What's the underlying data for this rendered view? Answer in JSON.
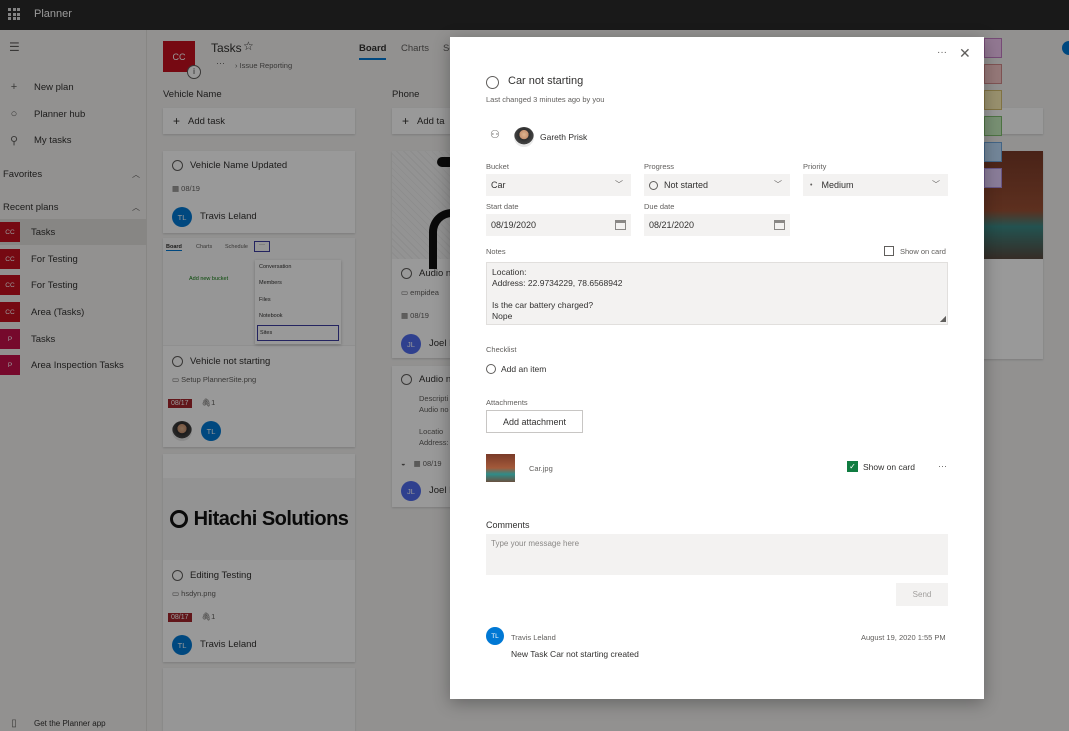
{
  "app": {
    "title": "Planner"
  },
  "nav": {
    "new_plan": "New plan",
    "planner_hub": "Planner hub",
    "my_tasks": "My tasks",
    "favorites": "Favorites",
    "recent_plans": "Recent plans",
    "plans": [
      {
        "initials": "CC",
        "name": "Tasks",
        "color": "#c50f1f"
      },
      {
        "initials": "CC",
        "name": "For Testing",
        "color": "#c50f1f"
      },
      {
        "initials": "CC",
        "name": "For Testing",
        "color": "#c50f1f"
      },
      {
        "initials": "CC",
        "name": "Area (Tasks)",
        "color": "#c50f1f"
      },
      {
        "initials": "P",
        "name": "Tasks",
        "color": "#c50f4a"
      },
      {
        "initials": "P",
        "name": "Area Inspection Tasks",
        "color": "#c50f4a"
      }
    ],
    "get_app": "Get the Planner app"
  },
  "plan_header": {
    "initials": "CC",
    "title": "Tasks",
    "breadcrumb": "Issue Reporting",
    "more": "···",
    "tabs": [
      "Board",
      "Charts",
      "Se"
    ]
  },
  "columns": [
    {
      "name": "Vehicle Name",
      "add_task": "Add task"
    },
    {
      "name": "Phone",
      "add_task": "Add ta"
    }
  ],
  "col1_cards": {
    "c1": {
      "title": "Vehicle Name Updated",
      "date": "08/19",
      "assignee_initials": "TL",
      "assignee": "Travis Leland"
    },
    "c2": {
      "thumb_tabs": [
        "Board",
        "Charts",
        "Schedule",
        "···"
      ],
      "thumb_add": "Add new bucket",
      "thumb_menu": [
        "Conversation",
        "Members",
        "Files",
        "Notebook",
        "Sites"
      ],
      "title": "Vehicle not starting",
      "attachment": "Setup PlannerSite.png",
      "date": "08/17",
      "attach_count": "1",
      "assignee_initials": "TL"
    },
    "c3": {
      "logo": "Hitachi Solutions",
      "title": "Editing Testing",
      "attachment": "hsdyn.png",
      "date": "08/17",
      "attach_count": "1",
      "assignee_initials": "TL",
      "assignee": "Travis Leland"
    }
  },
  "col2_cards": {
    "c1": {
      "title": "Audio n",
      "attachment": "empidea",
      "date": "08/19",
      "assignee_initials": "JL",
      "assignee": "Joel L"
    },
    "c2": {
      "title": "Audio n",
      "desc1": "Descripti",
      "desc2": "Audio no",
      "loc1": "Locatio",
      "loc2": "Address:",
      "date": "08/19",
      "assignee_initials": "JL",
      "assignee": "Joel L"
    }
  },
  "task": {
    "title": "Car not starting",
    "last_changed": "Last changed 3 minutes ago by you",
    "more": "···",
    "assignee": "Gareth Prisk",
    "bucket_label": "Bucket",
    "bucket": "Car",
    "progress_label": "Progress",
    "progress": "Not started",
    "priority_label": "Priority",
    "priority": "Medium",
    "start_label": "Start date",
    "start_date": "08/19/2020",
    "due_label": "Due date",
    "due_date": "08/21/2020",
    "notes_label": "Notes",
    "show_on_card": "Show on card",
    "notes_line1": "Location:",
    "notes_line2": "Address: 22.9734229, 78.6568942",
    "notes_line3": "Is the car battery charged?",
    "notes_line4": "Nope",
    "checklist_label": "Checklist",
    "add_item": "Add an item",
    "attachments_label": "Attachments",
    "add_attachment": "Add attachment",
    "attachment_name": "Car.jpg",
    "attachment_show": "Show on card",
    "attachment_more": "···",
    "comments_label": "Comments",
    "comment_placeholder": "Type your message here",
    "send": "Send",
    "comment": {
      "initials": "TL",
      "author": "Travis Leland",
      "time": "August 19, 2020 1:55 PM",
      "text": "New Task Car not starting created"
    }
  },
  "colors": {
    "accent": "#0078d4",
    "overdue": "#a4262c",
    "plan_red": "#c50f1f"
  }
}
